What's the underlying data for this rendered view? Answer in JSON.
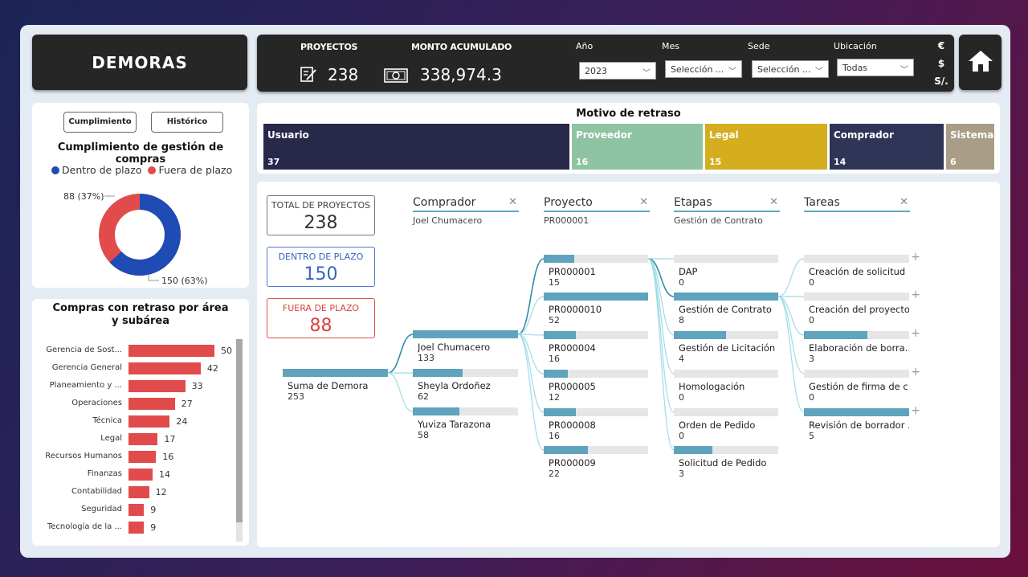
{
  "header": {
    "title": "DEMORAS"
  },
  "kpis": {
    "proyectos_label": "PROYECTOS",
    "proyectos_value": "238",
    "monto_label": "MONTO ACUMULADO",
    "monto_value": "338,974.3"
  },
  "filters": {
    "year": {
      "label": "Año",
      "value": "2023"
    },
    "month": {
      "label": "Mes",
      "value": "Selección ..."
    },
    "site": {
      "label": "Sede",
      "value": "Selección ..."
    },
    "location": {
      "label": "Ubicación",
      "value": "Todas"
    }
  },
  "currency": [
    "€",
    "$",
    "S/."
  ],
  "buttons": {
    "cumplimiento": "Cumplimiento",
    "historico": "Histórico"
  },
  "donut": {
    "title": "Cumplimiento de gestión de compras",
    "legend_in": "Dentro de plazo",
    "legend_out": "Fuera de plazo",
    "label_out": "88 (37%)",
    "label_in": "150 (63%)",
    "color_in": "#1f4bb4",
    "color_out": "#e14b4b",
    "value_in": 150,
    "value_out": 88
  },
  "area_chart": {
    "title": "Compras con retraso por área y subárea"
  },
  "chart_data": {
    "type": "bar",
    "orientation": "horizontal",
    "categories": [
      "Gerencia de Sost...",
      "Gerencia General",
      "Planeamiento y ...",
      "Operaciones",
      "Técnica",
      "Legal",
      "Recursos Humanos",
      "Finanzas",
      "Contabilidad",
      "Seguridad",
      "Tecnología de la ..."
    ],
    "values": [
      50,
      42,
      33,
      27,
      24,
      17,
      16,
      14,
      12,
      9,
      9
    ],
    "title": "Compras con retraso por área y subárea",
    "color": "#e14b4b"
  },
  "motivo": {
    "title": "Motivo de retraso",
    "cells": [
      {
        "label": "Usuario",
        "value": "37",
        "color": "#27284a"
      },
      {
        "label": "Proveedor",
        "value": "16",
        "color": "#8fc4a2"
      },
      {
        "label": "Legal",
        "value": "15",
        "color": "#d4ae1f"
      },
      {
        "label": "Comprador",
        "value": "14",
        "color": "#303457"
      },
      {
        "label": "Sistema",
        "value": "6",
        "color": "#a99d85"
      }
    ]
  },
  "tree": {
    "total": {
      "label": "TOTAL DE PROYECTOS",
      "value": "238"
    },
    "dentro": {
      "label": "DENTRO DE PLAZO",
      "value": "150"
    },
    "fuera": {
      "label": "FUERA DE PLAZO",
      "value": "88"
    },
    "levels": [
      {
        "title": "Comprador",
        "filter": "Joel Chumacero"
      },
      {
        "title": "Proyecto",
        "filter": "PR000001"
      },
      {
        "title": "Etapas",
        "filter": "Gestión de Contrato"
      },
      {
        "title": "Tareas",
        "filter": ""
      }
    ],
    "root": {
      "label": "Suma de Demora",
      "value": "253"
    },
    "compradores": [
      {
        "label": "Joel Chumacero",
        "value": "133",
        "fill": 1.0
      },
      {
        "label": "Sheyla Ordoñez",
        "value": "62",
        "fill": 0.47
      },
      {
        "label": "Yuviza Tarazona",
        "value": "58",
        "fill": 0.44
      }
    ],
    "proyectos": [
      {
        "label": "PR000001",
        "value": "15",
        "fill": 0.29
      },
      {
        "label": "PR0000010",
        "value": "52",
        "fill": 1.0
      },
      {
        "label": "PR000004",
        "value": "16",
        "fill": 0.31
      },
      {
        "label": "PR000005",
        "value": "12",
        "fill": 0.23
      },
      {
        "label": "PR000008",
        "value": "16",
        "fill": 0.31
      },
      {
        "label": "PR000009",
        "value": "22",
        "fill": 0.42
      }
    ],
    "etapas": [
      {
        "label": "DAP",
        "value": "0",
        "fill": 0.0
      },
      {
        "label": "Gestión de Contrato",
        "value": "8",
        "fill": 1.0
      },
      {
        "label": "Gestión de Licitación",
        "value": "4",
        "fill": 0.5
      },
      {
        "label": "Homologación",
        "value": "0",
        "fill": 0.0
      },
      {
        "label": "Orden de Pedido",
        "value": "0",
        "fill": 0.0
      },
      {
        "label": "Solicitud de Pedido",
        "value": "3",
        "fill": 0.37
      }
    ],
    "tareas": [
      {
        "label": "Creación de solicitud ...",
        "value": "0",
        "fill": 0.0
      },
      {
        "label": "Creación del proyecto...",
        "value": "0",
        "fill": 0.0
      },
      {
        "label": "Elaboración de borra...",
        "value": "3",
        "fill": 0.6
      },
      {
        "label": "Gestión de firma de c...",
        "value": "0",
        "fill": 0.0
      },
      {
        "label": "Revisión de borrador ...",
        "value": "5",
        "fill": 1.0
      }
    ]
  }
}
